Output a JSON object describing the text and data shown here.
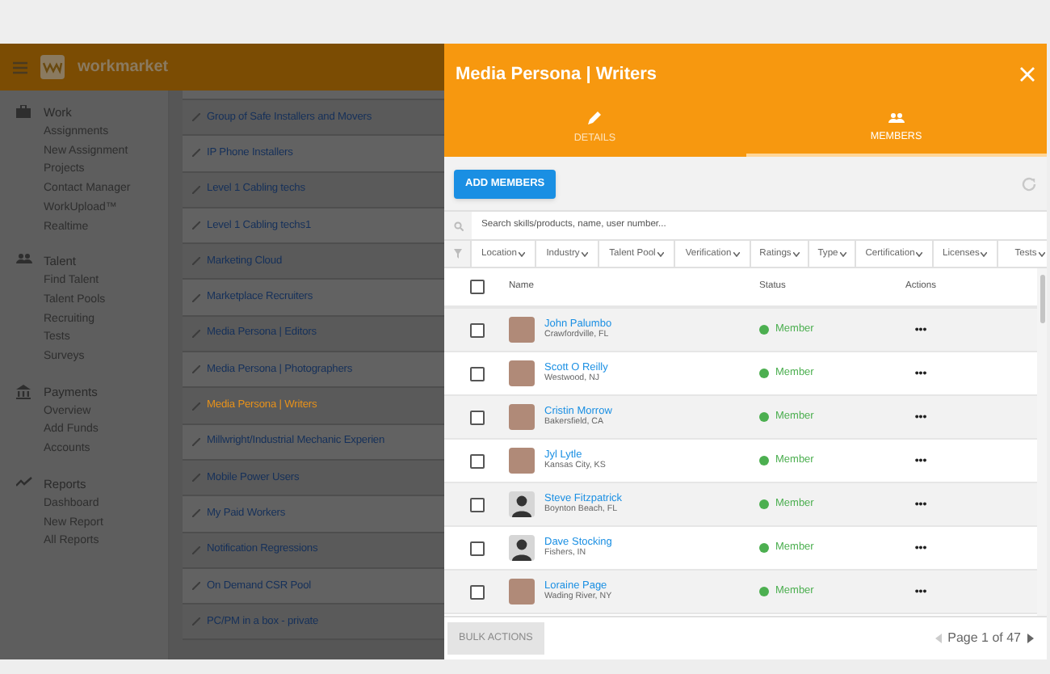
{
  "header": {
    "logo_text": "workmarket"
  },
  "sidebar": {
    "sections": [
      {
        "kind": "work",
        "title": "Work",
        "items": [
          "Assignments",
          "New Assignment",
          "Projects",
          "Contact Manager",
          "WorkUpload™",
          "Realtime"
        ]
      },
      {
        "kind": "talent",
        "title": "Talent",
        "items": [
          "Find Talent",
          "Talent Pools",
          "Recruiting",
          "Tests",
          "Surveys"
        ]
      },
      {
        "kind": "payments",
        "title": "Payments",
        "items": [
          "Overview",
          "Add Funds",
          "Accounts"
        ]
      },
      {
        "kind": "reports",
        "title": "Reports",
        "items": [
          "Dashboard",
          "New Report",
          "All Reports"
        ]
      }
    ]
  },
  "groups": [
    {
      "label": "Group of Safe Installers and Movers",
      "selected": false
    },
    {
      "label": "IP Phone Installers",
      "selected": false
    },
    {
      "label": "Level 1 Cabling techs",
      "selected": false
    },
    {
      "label": "Level 1 Cabling techs1",
      "selected": false
    },
    {
      "label": "Marketing Cloud",
      "selected": false
    },
    {
      "label": "Marketplace Recruiters",
      "selected": false
    },
    {
      "label": "Media Persona | Editors",
      "selected": false
    },
    {
      "label": "Media Persona | Photographers",
      "selected": false
    },
    {
      "label": "Media Persona | Writers",
      "selected": true
    },
    {
      "label": "Millwright/Industrial Mechanic Experien",
      "selected": false
    },
    {
      "label": "Mobile Power Users",
      "selected": false
    },
    {
      "label": "My Paid Workers",
      "selected": false
    },
    {
      "label": "Notification Regressions",
      "selected": false
    },
    {
      "label": "On Demand CSR Pool",
      "selected": false
    },
    {
      "label": "PC/PM in a box - private",
      "selected": false
    }
  ],
  "panel": {
    "title": "Media Persona | Writers",
    "tabs": [
      {
        "kind": "details",
        "label": "DETAILS",
        "selected": false
      },
      {
        "kind": "members",
        "label": "MEMBERS",
        "selected": true
      }
    ],
    "add_button": "ADD MEMBERS",
    "search": {
      "placeholder": "Search skills/products, name, user number..."
    },
    "filters": [
      "Location",
      "Industry",
      "Talent Pool",
      "Verification",
      "Ratings",
      "Type",
      "Certification",
      "Licenses",
      "Tests"
    ],
    "table": {
      "columns": [
        "Name",
        "Status",
        "Actions"
      ],
      "select_all_checked": false,
      "rows": [
        {
          "name": "John Palumbo",
          "location": "Crawfordville, FL",
          "kind": "photo",
          "status": "Member",
          "actions": "•••",
          "checked": false
        },
        {
          "name": "Scott O Reilly",
          "location": "Westwood, NJ",
          "kind": "photo",
          "status": "Member",
          "actions": "•••",
          "checked": false
        },
        {
          "name": "Cristin Morrow",
          "location": "Bakersfield, CA",
          "kind": "photo",
          "status": "Member",
          "actions": "•••",
          "checked": false
        },
        {
          "name": "Jyl Lytle",
          "location": "Kansas City, KS",
          "kind": "photo",
          "status": "Member",
          "actions": "•••",
          "checked": false
        },
        {
          "name": "Steve Fitzpatrick",
          "location": "Boynton Beach, FL",
          "kind": "silhouette",
          "status": "Member",
          "actions": "•••",
          "checked": false
        },
        {
          "name": "Dave Stocking",
          "location": "Fishers, IN",
          "kind": "silhouette",
          "status": "Member",
          "actions": "•••",
          "checked": false
        },
        {
          "name": "Loraine Page",
          "location": "Wading River, NY",
          "kind": "photo",
          "status": "Member",
          "actions": "•••",
          "checked": false
        }
      ]
    },
    "bulk_button": {
      "label": "BULK ACTIONS",
      "disabled": true
    },
    "pagination": "Page 1 of 47"
  }
}
